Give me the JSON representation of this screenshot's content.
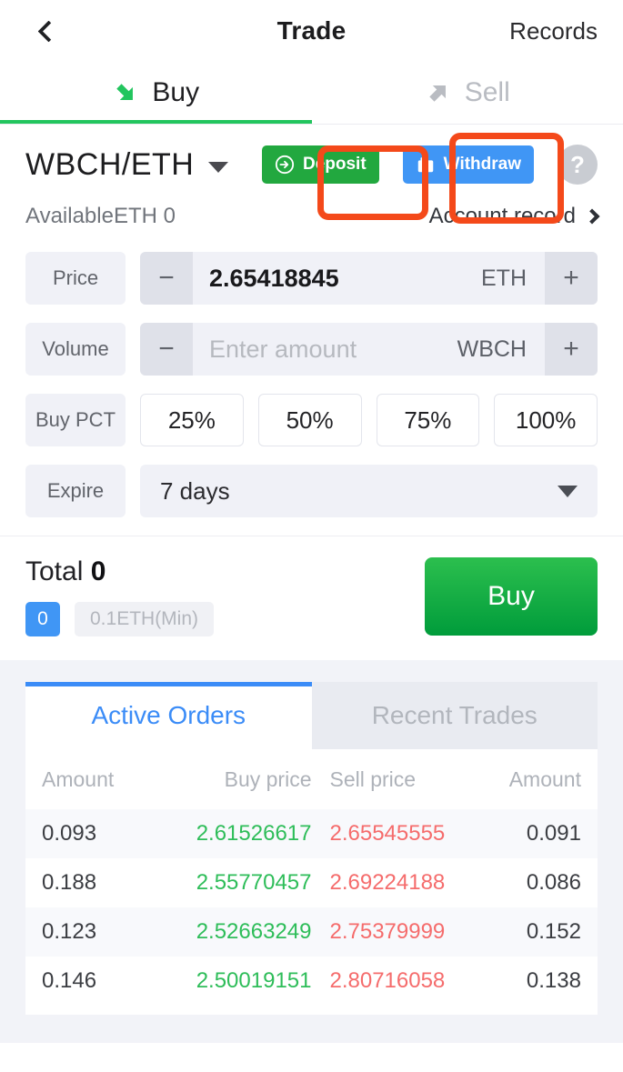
{
  "nav": {
    "back_icon": "chevron-left-icon",
    "title": "Trade",
    "records_label": "Records"
  },
  "side_tabs": {
    "buy": {
      "label": "Buy",
      "icon": "arrow-down-right-icon",
      "active": true
    },
    "sell": {
      "label": "Sell",
      "icon": "arrow-up-right-icon",
      "active": false
    },
    "active_color": "#22c55e"
  },
  "pair": {
    "symbol": "WBCH/ETH",
    "dropdown_icon": "caret-down-icon",
    "deposit_label": "Deposit",
    "deposit_icon": "circle-arrow-right-icon",
    "deposit_color": "#22a83f",
    "withdraw_label": "Withdraw",
    "withdraw_icon": "wallet-icon",
    "withdraw_color": "#4096f5",
    "help_label": "?",
    "annotation_color": "#f4491a"
  },
  "balance": {
    "available_label": "AvailableETH 0",
    "account_record_label": "Account record",
    "account_record_icon": "chevron-right-icon"
  },
  "form": {
    "price": {
      "tag": "Price",
      "minus": "−",
      "plus": "+",
      "value": "2.65418845",
      "unit": "ETH"
    },
    "volume": {
      "tag": "Volume",
      "minus": "−",
      "plus": "+",
      "value": "",
      "placeholder": "Enter amount",
      "unit": "WBCH"
    },
    "buy_pct": {
      "tag": "Buy PCT",
      "options": [
        "25%",
        "50%",
        "75%",
        "100%"
      ]
    },
    "expire": {
      "tag": "Expire",
      "selected": "7 days",
      "caret_icon": "caret-down-icon"
    }
  },
  "total": {
    "label": "Total",
    "value": "0",
    "badge": "0",
    "min_hint": "0.1ETH(Min)",
    "cta_label": "Buy",
    "badge_color": "#4096f5",
    "cta_color": "#009c3b"
  },
  "orderbook": {
    "tabs": [
      {
        "label": "Active Orders",
        "active": true
      },
      {
        "label": "Recent Trades",
        "active": false
      }
    ],
    "columns": [
      "Amount",
      "Buy price",
      "Sell price",
      "Amount"
    ],
    "buy_color": "#2ebd59",
    "sell_color": "#f56c6c",
    "rows": [
      {
        "buy_amount": "0.093",
        "buy_price": "2.61526617",
        "sell_price": "2.65545555",
        "sell_amount": "0.091"
      },
      {
        "buy_amount": "0.188",
        "buy_price": "2.55770457",
        "sell_price": "2.69224188",
        "sell_amount": "0.086"
      },
      {
        "buy_amount": "0.123",
        "buy_price": "2.52663249",
        "sell_price": "2.75379999",
        "sell_amount": "0.152"
      },
      {
        "buy_amount": "0.146",
        "buy_price": "2.50019151",
        "sell_price": "2.80716058",
        "sell_amount": "0.138"
      }
    ]
  }
}
